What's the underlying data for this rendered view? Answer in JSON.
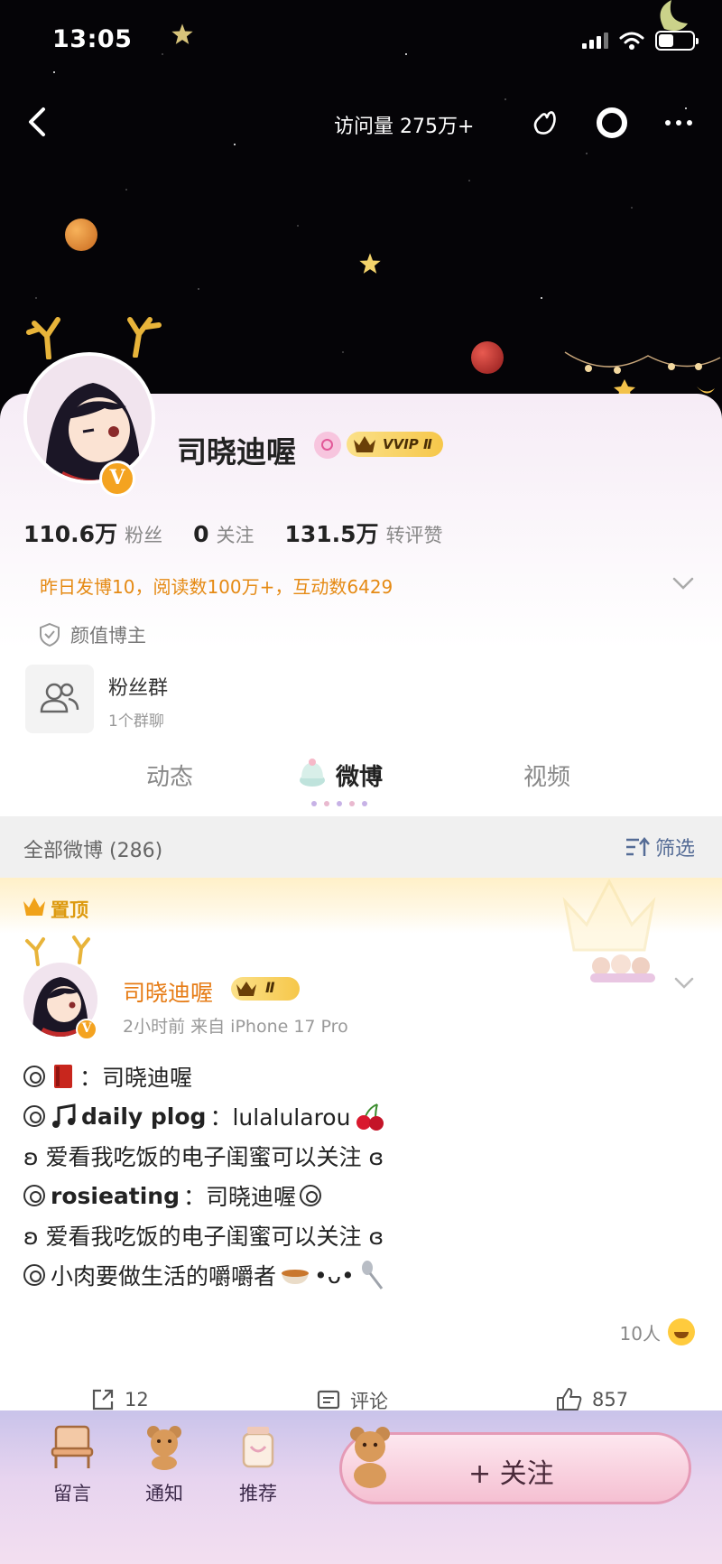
{
  "status_bar": {
    "time": "13:05"
  },
  "nav": {
    "visits_label": "访问量 275万+"
  },
  "profile": {
    "name": "司晓迪喔",
    "vip_badge": "VVIP Ⅱ",
    "verified_mark": "V",
    "stats": [
      {
        "value": "110.6万",
        "label": "粉丝"
      },
      {
        "value": "0",
        "label": "关注"
      },
      {
        "value": "131.5万",
        "label": "转评赞"
      }
    ],
    "summary": "昨日发博10，阅读数100万+，互动数6429",
    "tag": "颜值博主",
    "fans_group": {
      "title": "粉丝群",
      "subtitle": "1个群聊"
    }
  },
  "tabs": [
    {
      "label": "动态",
      "active": false
    },
    {
      "label": "微博",
      "active": true
    },
    {
      "label": "视频",
      "active": false
    }
  ],
  "filter_bar": {
    "title": "全部微博 (286)",
    "filter_label": "筛选"
  },
  "pinned": {
    "label": "置顶"
  },
  "post": {
    "author": "司晓迪喔",
    "crown_badge": "Ⅱ",
    "meta": "2小时前  来自 iPhone 17 Pro",
    "lines": {
      "l1": "：司晓迪喔",
      "l2_bold": "daily plog",
      "l2_rest": "：lulalularou",
      "l3": "ʚ 爱看我吃饭的电子闺蜜可以关注 ɞ",
      "l4_bold": "rosieating",
      "l4_rest": "：司晓迪喔",
      "l5": "ʚ 爱看我吃饭的电子闺蜜可以关注 ɞ",
      "l6": "小肉要做生活的嚼嚼者",
      "l6_kaomoji": "•ᴗ•"
    },
    "reactions": "10人",
    "actions": {
      "repost": "12",
      "comment": "评论",
      "like": "857"
    }
  },
  "bottom_bar": {
    "items": [
      {
        "label": "留言",
        "icon": "chair-icon"
      },
      {
        "label": "通知",
        "icon": "bear-icon"
      },
      {
        "label": "推荐",
        "icon": "gift-jar-icon"
      }
    ],
    "follow_label": "+ 关注"
  },
  "colors": {
    "accent_orange": "#e58a14",
    "pinned_gold": "#dd9a0f",
    "link_blue": "#556c96",
    "vip_gold": "#f6c74a"
  }
}
